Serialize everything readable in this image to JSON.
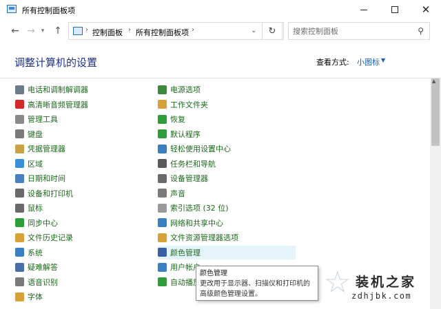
{
  "window": {
    "title": "所有控制面板项"
  },
  "navigation": {
    "breadcrumb": [
      "控制面板",
      "所有控制面板项"
    ],
    "search_placeholder": "搜索控制面板"
  },
  "header": {
    "title": "调整计算机的设置",
    "view_label": "查看方式:",
    "view_value": "小图标"
  },
  "items_left": [
    {
      "label": "电话和调制解调器",
      "icon": "phone-modem-icon",
      "color": "#6b7b8c"
    },
    {
      "label": "高清晰音频管理器",
      "icon": "audio-manager-icon",
      "color": "#d42a2a"
    },
    {
      "label": "管理工具",
      "icon": "admin-tools-icon",
      "color": "#8a8a8a"
    },
    {
      "label": "键盘",
      "icon": "keyboard-icon",
      "color": "#7a7a7a"
    },
    {
      "label": "凭据管理器",
      "icon": "credential-manager-icon",
      "color": "#c9a248"
    },
    {
      "label": "区域",
      "icon": "region-icon",
      "color": "#3a8fd9"
    },
    {
      "label": "日期和时间",
      "icon": "date-time-icon",
      "color": "#4a7fc1"
    },
    {
      "label": "设备和打印机",
      "icon": "devices-printers-icon",
      "color": "#6a6a6a"
    },
    {
      "label": "鼠标",
      "icon": "mouse-icon",
      "color": "#6a6a6a"
    },
    {
      "label": "同步中心",
      "icon": "sync-center-icon",
      "color": "#2e9e3a"
    },
    {
      "label": "文件历史记录",
      "icon": "file-history-icon",
      "color": "#d9a13a"
    },
    {
      "label": "系统",
      "icon": "system-icon",
      "color": "#3a7fc1"
    },
    {
      "label": "疑难解答",
      "icon": "troubleshooting-icon",
      "color": "#4a6fa8"
    },
    {
      "label": "语音识别",
      "icon": "speech-recognition-icon",
      "color": "#7a7a7a"
    },
    {
      "label": "字体",
      "icon": "fonts-icon",
      "color": "#d9a13a"
    }
  ],
  "items_right": [
    {
      "label": "电源选项",
      "icon": "power-options-icon",
      "color": "#3a8a3a"
    },
    {
      "label": "工作文件夹",
      "icon": "work-folders-icon",
      "color": "#d9a13a"
    },
    {
      "label": "恢复",
      "icon": "recovery-icon",
      "color": "#2e9e3a"
    },
    {
      "label": "默认程序",
      "icon": "default-programs-icon",
      "color": "#2e9e3a"
    },
    {
      "label": "轻松使用设置中心",
      "icon": "ease-of-access-icon",
      "color": "#3a7fc1"
    },
    {
      "label": "任务栏和导航",
      "icon": "taskbar-icon",
      "color": "#5a5a5a"
    },
    {
      "label": "设备管理器",
      "icon": "device-manager-icon",
      "color": "#6a6a6a"
    },
    {
      "label": "声音",
      "icon": "sound-icon",
      "color": "#7a7a7a"
    },
    {
      "label": "索引选项 (32 位)",
      "icon": "indexing-options-icon",
      "color": "#9a9a9a"
    },
    {
      "label": "网络和共享中心",
      "icon": "network-sharing-icon",
      "color": "#3a7fc1"
    },
    {
      "label": "文件资源管理器选项",
      "icon": "file-explorer-options-icon",
      "color": "#d9a13a"
    },
    {
      "label": "颜色管理",
      "icon": "color-management-icon",
      "color": "#3a5fa8"
    },
    {
      "label": "用户帐户",
      "icon": "user-accounts-icon",
      "color": "#3a7fc1"
    },
    {
      "label": "自动播放",
      "icon": "autoplay-icon",
      "color": "#2e9e3a"
    }
  ],
  "tooltip": {
    "title": "颜色管理",
    "line1": "更改用于显示器、扫描仪和打印机的",
    "line2": "高级颜色管理设置。"
  },
  "watermark": {
    "text": "装机之家",
    "url": "zdhjbk.com"
  }
}
